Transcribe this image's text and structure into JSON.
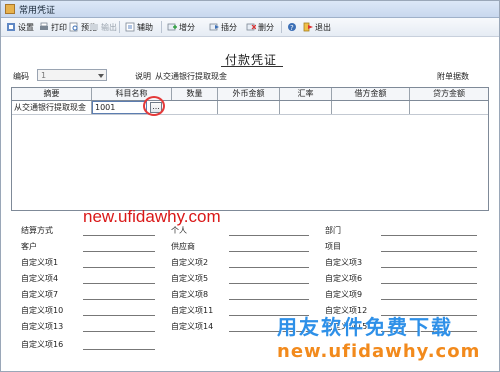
{
  "window": {
    "title": "常用凭证"
  },
  "toolbar": {
    "items": [
      {
        "label": "设置"
      },
      {
        "label": "打印"
      },
      {
        "label": "预览"
      },
      {
        "label": "输出"
      },
      {
        "label": "辅助"
      },
      {
        "label": "增分"
      },
      {
        "label": "插分"
      },
      {
        "label": "删分"
      },
      {
        "label": "退出"
      }
    ]
  },
  "voucher": {
    "title": "付款凭证",
    "code_label": "编码",
    "code_value": "1",
    "desc_label": "说明",
    "desc_value": "从交通银行提取现金",
    "attach_label": "附单据数"
  },
  "grid": {
    "headers": [
      "摘要",
      "科目名称",
      "数量",
      "外币金额",
      "汇率",
      "借方金额",
      "贷方金额"
    ],
    "rows": [
      {
        "summary": "从交通银行提取现金",
        "account": "1001",
        "qty": "",
        "fx": "",
        "rate": "",
        "debit": "",
        "credit": ""
      }
    ],
    "ellipsis": "..."
  },
  "footer": {
    "col1": [
      "结算方式",
      "客户",
      "自定义项1",
      "自定义项4",
      "自定义项7",
      "自定义项10",
      "自定义项13",
      "自定义项16"
    ],
    "col2": [
      "个人",
      "供应商",
      "自定义项2",
      "自定义项5",
      "自定义项8",
      "自定义项11",
      "自定义项14"
    ],
    "col3": [
      "部门",
      "项目",
      "自定义项3",
      "自定义项6",
      "自定义项9",
      "自定义项12",
      "自定义项15"
    ]
  },
  "watermarks": {
    "url_red": "new.ufidawhy.com",
    "cn_blue": "用友软件免费下载",
    "url_orange": "new.ufidawhy.com"
  }
}
